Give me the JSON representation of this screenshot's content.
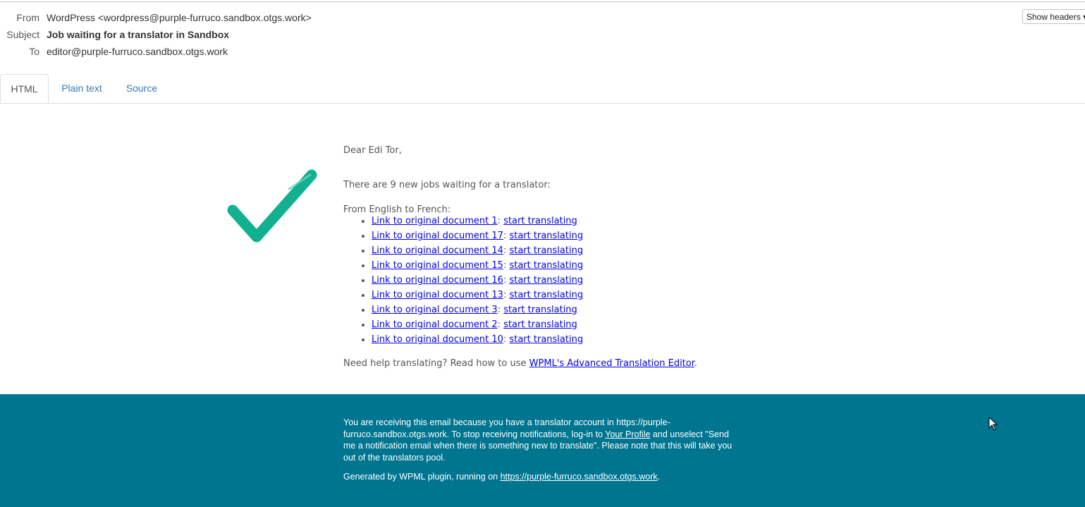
{
  "headers": {
    "from_label": "From",
    "from_value": "WordPress <wordpress@purple-furruco.sandbox.otgs.work>",
    "subject_label": "Subject",
    "subject_value": "Job waiting for a translator in Sandbox",
    "to_label": "To",
    "to_value": "editor@purple-furruco.sandbox.otgs.work",
    "show_headers_label": "Show headers"
  },
  "tabs": [
    {
      "label": "HTML",
      "active": true
    },
    {
      "label": "Plain text",
      "active": false
    },
    {
      "label": "Source",
      "active": false
    }
  ],
  "email": {
    "greeting": "Dear Edi Tor,",
    "intro": "There are 9 new jobs waiting for a translator:",
    "language_pair": "From English to French:",
    "jobs": [
      {
        "doc_link": "Link to original document 1",
        "action": "start translating"
      },
      {
        "doc_link": "Link to original document 17",
        "action": "start translating"
      },
      {
        "doc_link": "Link to original document 14",
        "action": "start translating"
      },
      {
        "doc_link": "Link to original document 15",
        "action": "start translating"
      },
      {
        "doc_link": "Link to original document 16",
        "action": "start translating"
      },
      {
        "doc_link": "Link to original document 13",
        "action": "start translating"
      },
      {
        "doc_link": "Link to original document 3",
        "action": "start translating"
      },
      {
        "doc_link": "Link to original document 2",
        "action": "start translating"
      },
      {
        "doc_link": "Link to original document 10",
        "action": "start translating"
      }
    ],
    "separator": ":",
    "help_prefix": "Need help translating? Read how to use ",
    "help_link": "WPML's Advanced Translation Editor",
    "help_suffix": "."
  },
  "footer": {
    "notice_part1": "You are receiving this email because you have a translator account in https://purple-furruco.sandbox.otgs.work. To stop receiving notifications, log-in to ",
    "profile_link": "Your Profile",
    "notice_part2": " and unselect \"Send me a notification email when there is something new to translate\". Please note that this will take you out of the translators pool.",
    "generated_prefix": "Generated by WPML plugin, running on ",
    "site_link": "https://purple-furruco.sandbox.otgs.work",
    "generated_suffix": "."
  },
  "colors": {
    "footer_bg": "#007590",
    "checkmark": "#11b08f",
    "link": "#0000ee",
    "tab_link": "#337ab7"
  },
  "icons": {
    "checkmark": "checkmark-icon",
    "cursor": "mouse-cursor-icon"
  }
}
